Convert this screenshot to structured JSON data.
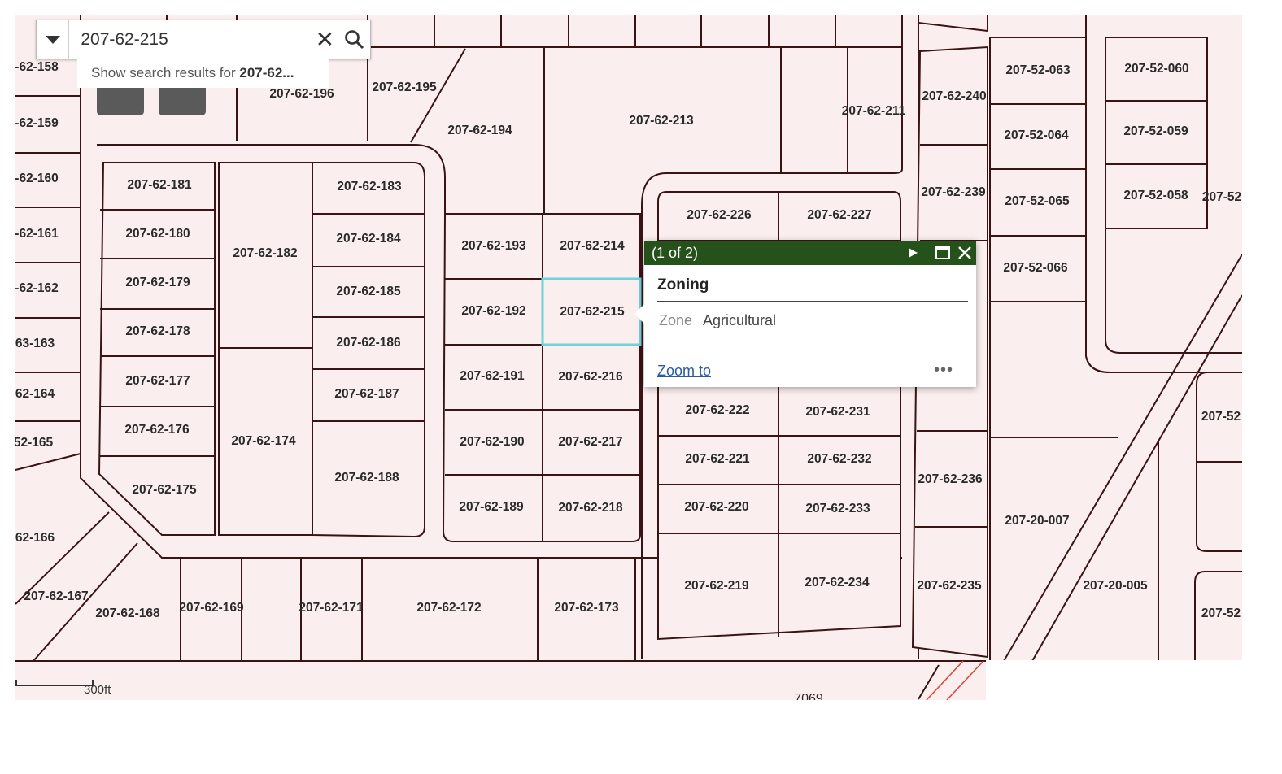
{
  "search": {
    "value": "207-62-215",
    "suggestion_prefix": "Show search results for ",
    "suggestion_term": "207-62..."
  },
  "popup": {
    "counter": "(1 of 2)",
    "title": "Zoning",
    "attribute_name": "Zone",
    "attribute_value": "Agricultural",
    "zoom_link": "Zoom to",
    "more": "•••",
    "header_color": "#25521a"
  },
  "scale": {
    "label": "300ft"
  },
  "map": {
    "selected_parcel": "207-62-215",
    "selection_color": "#6fd3d8",
    "parcel_fill": "#fbeeee",
    "parcel_outline": "#3a1414",
    "partial_label": "7069",
    "parcels": [
      "-62-158",
      "-62-159",
      "-62-160",
      "-62-161",
      "-62-162",
      "63-163",
      "62-164",
      "52-165",
      "62-166",
      "207-62-167",
      "207-62-168",
      "207-62-169",
      "207-62-171",
      "207-62-172",
      "207-62-173",
      "207-62-196",
      "207-62-195",
      "207-62-194",
      "207-62-213",
      "207-62-211",
      "207-62-181",
      "207-62-180",
      "207-62-179",
      "207-62-178",
      "207-62-177",
      "207-62-176",
      "207-62-175",
      "207-62-182",
      "207-62-174",
      "207-62-183",
      "207-62-184",
      "207-62-185",
      "207-62-186",
      "207-62-187",
      "207-62-188",
      "207-62-193",
      "207-62-192",
      "207-62-191",
      "207-62-190",
      "207-62-189",
      "207-62-214",
      "207-62-215",
      "207-62-216",
      "207-62-217",
      "207-62-218",
      "207-62-226",
      "207-62-227",
      "207-62-222",
      "207-62-231",
      "207-62-221",
      "207-62-232",
      "207-62-220",
      "207-62-233",
      "207-62-219",
      "207-62-234",
      "207-62-240",
      "207-62-239",
      "207-62-236",
      "207-62-235",
      "207-52-063",
      "207-52-064",
      "207-52-065",
      "207-52-066",
      "207-52-060",
      "207-52-059",
      "207-52-058",
      "207-52",
      "207-20-007",
      "207-20-005",
      "207-52",
      "207-52"
    ]
  }
}
